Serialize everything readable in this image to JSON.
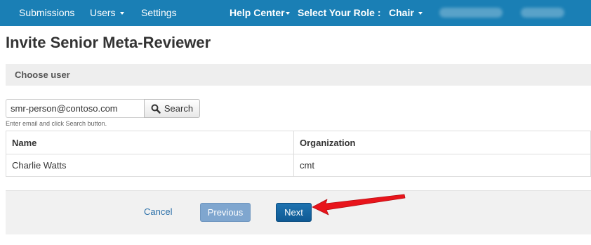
{
  "nav": {
    "submissions": "Submissions",
    "users": "Users",
    "settings": "Settings",
    "help_center": "Help Center",
    "role_label": "Select Your Role :",
    "role_value": "Chair"
  },
  "page": {
    "title": "Invite Senior Meta-Reviewer",
    "section": "Choose user"
  },
  "search": {
    "value": "smr-person@contoso.com",
    "button_label": "Search",
    "hint": "Enter email and click Search button."
  },
  "table": {
    "headers": [
      "Name",
      "Organization"
    ],
    "rows": [
      {
        "name": "Charlie Watts",
        "organization": "cmt"
      }
    ]
  },
  "footer": {
    "cancel": "Cancel",
    "previous": "Previous",
    "next": "Next"
  },
  "colors": {
    "nav_bg": "#1a7fb5",
    "primary": "#0f5a94",
    "annotation_arrow": "#e8141b"
  }
}
